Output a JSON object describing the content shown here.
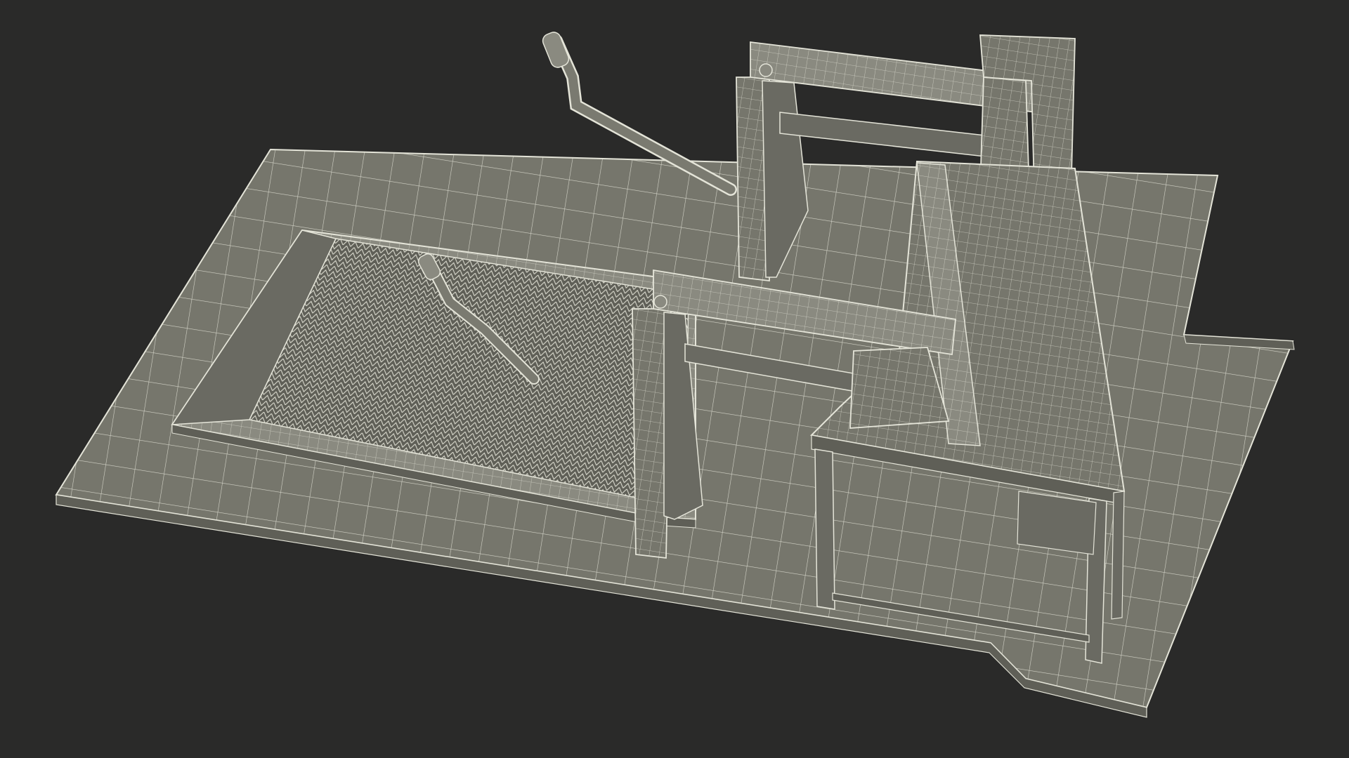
{
  "scene": {
    "subject": "",
    "colors": {
      "background": "#2a2a29",
      "surface": "#76766c",
      "surface_dark": "#5f5f57",
      "surface_light": "#8a8a80",
      "wire": "#e4e4d8"
    }
  }
}
